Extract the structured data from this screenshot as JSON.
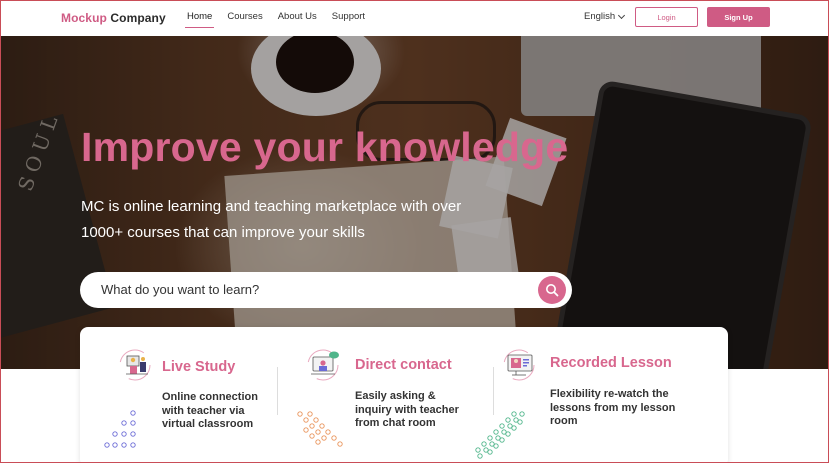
{
  "brand": {
    "part1": "Mockup",
    "part2": " Company"
  },
  "nav": [
    {
      "label": "Home",
      "active": true
    },
    {
      "label": "Courses",
      "active": false
    },
    {
      "label": "About Us",
      "active": false
    },
    {
      "label": "Support",
      "active": false
    }
  ],
  "language": {
    "label": "English"
  },
  "buttons": {
    "login": "Login",
    "signup": "Sign Up"
  },
  "hero": {
    "title": "Improve your knowledge",
    "subtitle_line1": "MC is online learning  and teaching marketplace with over",
    "subtitle_line2": "1000+ courses  that can improve your skills",
    "book_text": "SOUL"
  },
  "search": {
    "placeholder": "What do you want to learn?"
  },
  "features": [
    {
      "title": "Live Study",
      "desc_lines": [
        "Online connection",
        "with teacher via",
        "virtual classroom"
      ]
    },
    {
      "title": "Direct contact",
      "desc_lines": [
        "Easily asking &",
        "inquiry with teacher",
        "from chat room"
      ]
    },
    {
      "title": "Recorded Lesson",
      "desc_lines": [
        "Flexibility re-watch the",
        "lessons from my lesson",
        "room"
      ]
    }
  ],
  "colors": {
    "accent": "#cf5b84",
    "hero_title": "#d8678e",
    "border": "#c94d57"
  }
}
